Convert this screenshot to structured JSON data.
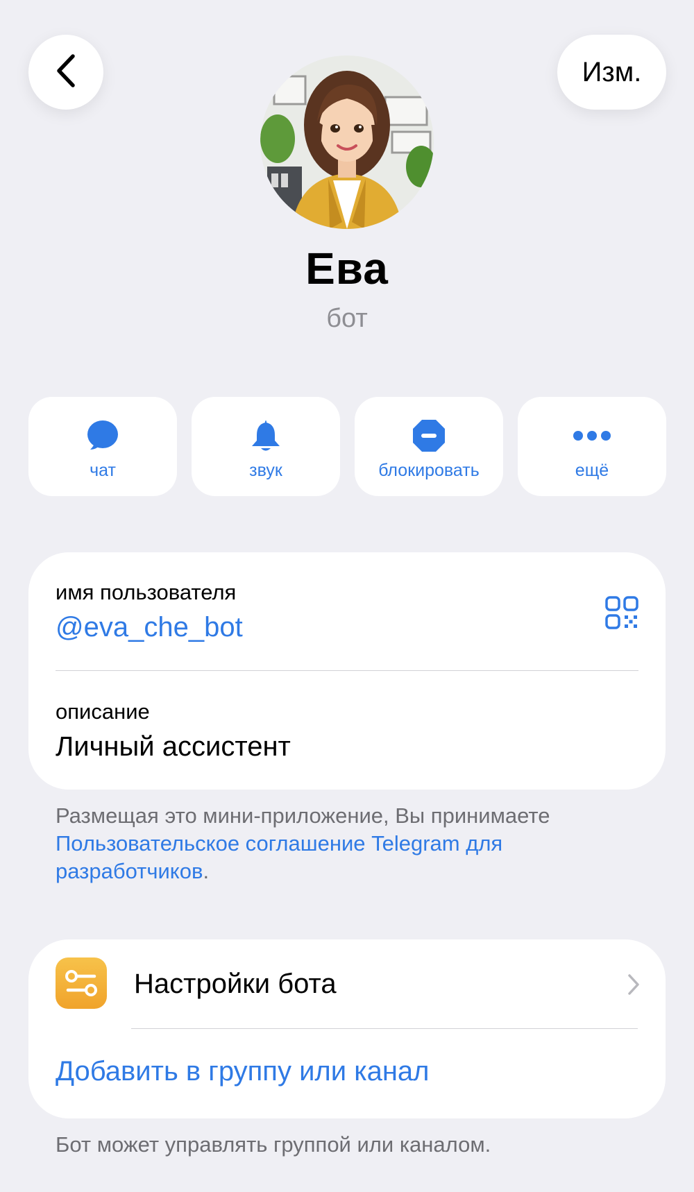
{
  "header": {
    "back_icon": "chevron-left-icon",
    "edit_label": "Изм."
  },
  "profile": {
    "name": "Ева",
    "subtitle": "бот",
    "avatar": "cartoon-woman-avatar"
  },
  "actions": [
    {
      "label": "чат",
      "icon": "chat-bubble-icon"
    },
    {
      "label": "звук",
      "icon": "bell-icon"
    },
    {
      "label": "блокировать",
      "icon": "block-icon"
    },
    {
      "label": "ещё",
      "icon": "more-dots-icon"
    }
  ],
  "info": {
    "username_caption": "имя пользователя",
    "username_value": "@eva_che_bot",
    "qr_icon": "qr-code-icon",
    "description_caption": "описание",
    "description_value": "Личный ассистент"
  },
  "agreement": {
    "text": "Размещая это мини-приложение, Вы принимаете ",
    "link": "Пользовательское соглашение Telegram для разработчиков",
    "end": "."
  },
  "settings": {
    "bot_settings_label": "Настройки бота",
    "add_to_group_label": "Добавить в группу или канал"
  },
  "footer_note": "Бот может управлять группой или каналом.",
  "colors": {
    "accent": "#2f7ae5",
    "background": "#efeff4",
    "settings_icon": "#f2ab33"
  }
}
